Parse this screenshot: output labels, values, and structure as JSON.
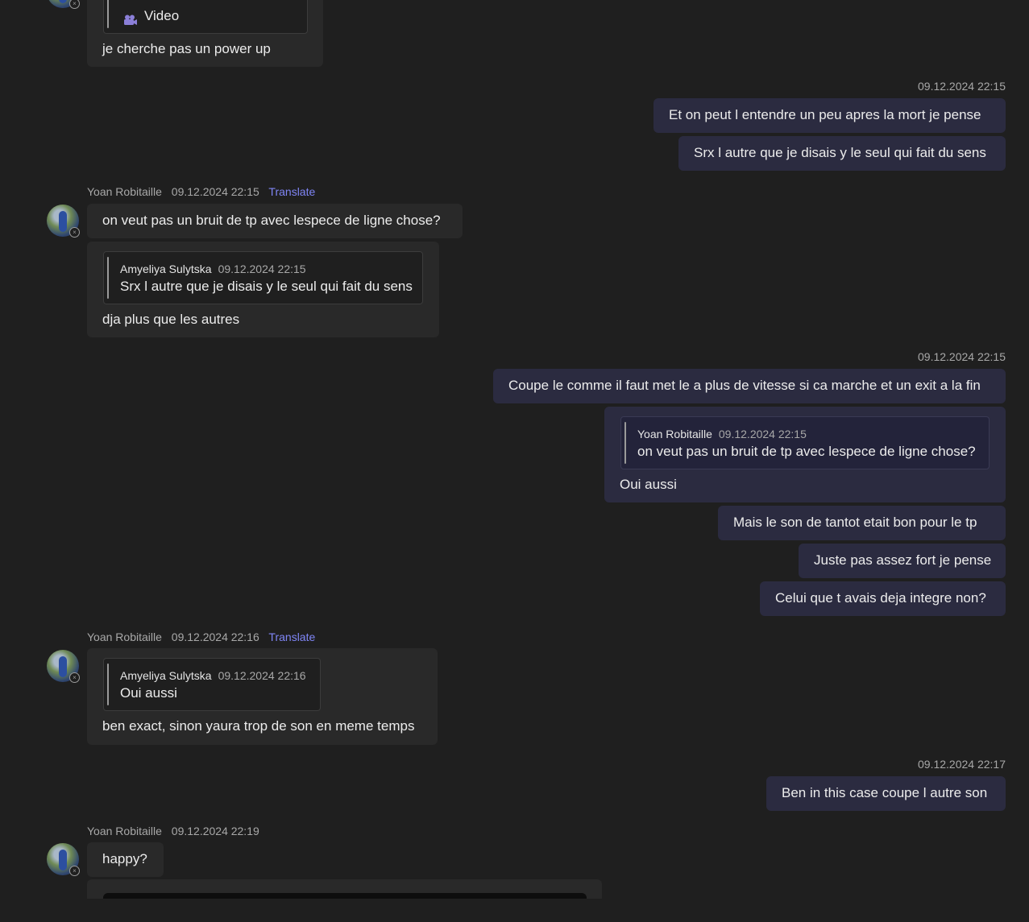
{
  "colors": {
    "background": "#1f1f1f",
    "incoming_bubble": "#292929",
    "outgoing_bubble": "#2b2b40",
    "translate_link": "#7f85f5",
    "meta_text": "#a8a8a8"
  },
  "top_partial": {
    "quote_text": "Video",
    "quote_icon": "video-icon",
    "reply": "je cherche pas un power up"
  },
  "group1": {
    "timestamp": "09.12.2024 22:15",
    "messages": [
      "Et on peut l entendre un peu apres la mort je pense",
      "Srx l autre que je disais y le seul qui fait du sens"
    ]
  },
  "group2": {
    "sender": "Yoan Robitaille",
    "timestamp": "09.12.2024 22:15",
    "translate": "Translate",
    "message1": "on veut pas un bruit de tp avec lespece de ligne chose?",
    "quote_sender": "Amyeliya Sulytska",
    "quote_time": "09.12.2024 22:15",
    "quote_text": "Srx l autre que je disais y le seul qui fait du sens",
    "reply": "dja plus que les autres"
  },
  "group3": {
    "timestamp": "09.12.2024 22:15",
    "message1": "Coupe le comme il faut met le a plus de vitesse si ca marche et un exit a la fin",
    "quote_sender": "Yoan Robitaille",
    "quote_time": "09.12.2024 22:15",
    "quote_text": "on veut pas un bruit de tp avec lespece de ligne chose?",
    "reply": "Oui aussi",
    "message3": "Mais le son de tantot etait bon pour le tp",
    "message4": "Juste pas assez fort je pense",
    "message5": "Celui que t avais deja integre non?"
  },
  "group4": {
    "sender": "Yoan Robitaille",
    "timestamp": "09.12.2024 22:16",
    "translate": "Translate",
    "quote_sender": "Amyeliya Sulytska",
    "quote_time": "09.12.2024 22:16",
    "quote_text": "Oui aussi",
    "reply": "ben exact, sinon yaura trop de son en meme temps"
  },
  "group5": {
    "timestamp": "09.12.2024 22:17",
    "message": "Ben in this case coupe l autre son"
  },
  "group6": {
    "sender": "Yoan Robitaille",
    "timestamp": "09.12.2024 22:19",
    "message": "happy?"
  }
}
